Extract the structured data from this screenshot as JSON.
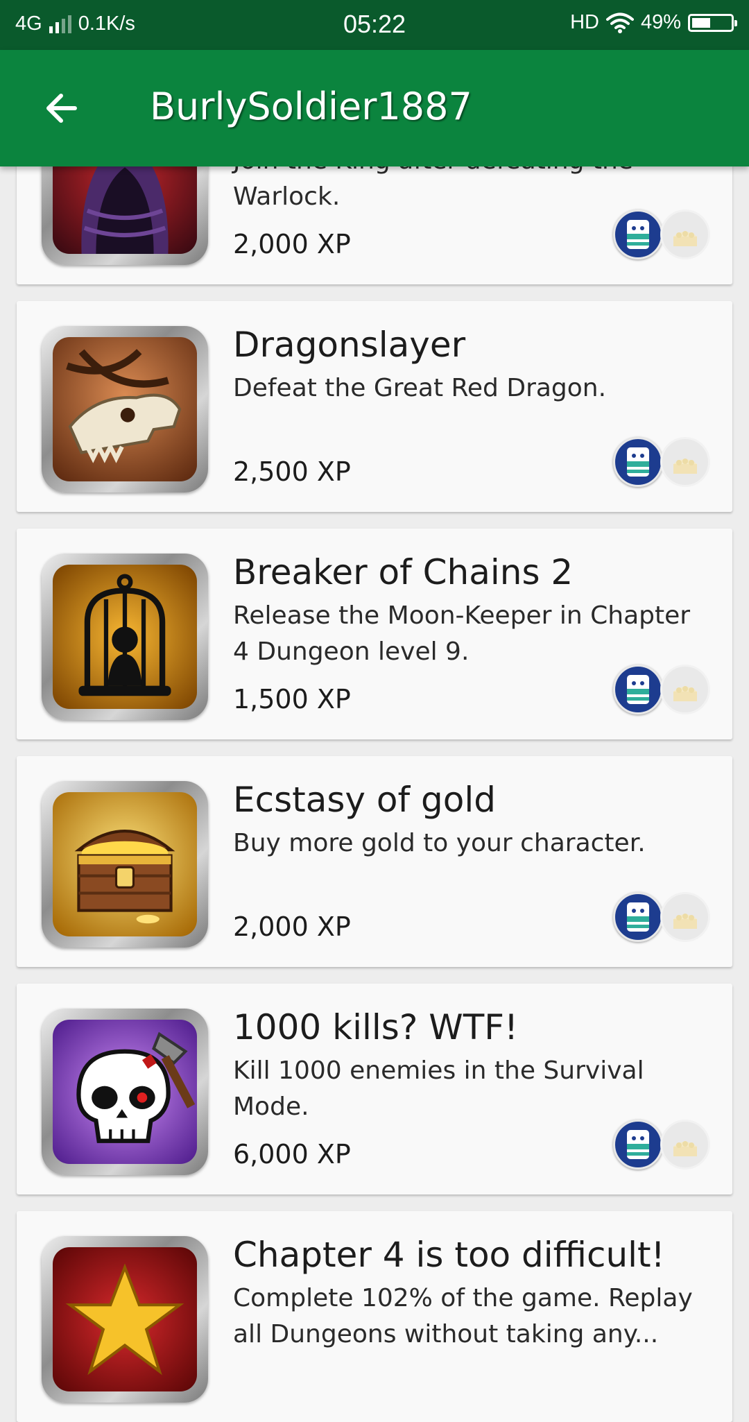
{
  "status_bar": {
    "network": "4G",
    "speed": "0.1K/s",
    "time": "05:22",
    "hd": "HD",
    "battery_text": "49%",
    "battery_level": 0.49
  },
  "header": {
    "title": "BurlySoldier1887",
    "back_icon": "arrow-back-icon"
  },
  "achievements": [
    {
      "title": "",
      "description": "Join the King after defeating the Warlock.",
      "xp": "2,000 XP",
      "icon": "hooded-warlock-icon",
      "colors": {
        "bg1": "#c3262b",
        "bg2": "#3c0a12"
      }
    },
    {
      "title": "Dragonslayer",
      "description": "Defeat the Great Red Dragon.",
      "xp": "2,500 XP",
      "icon": "dragon-skull-icon",
      "colors": {
        "bg1": "#d98a52",
        "bg2": "#5e2a10"
      }
    },
    {
      "title": "Breaker of Chains 2",
      "description": "Release the Moon-Keeper in Chapter 4 Dungeon level 9.",
      "xp": "1,500 XP",
      "icon": "birdcage-icon",
      "colors": {
        "bg1": "#f7b632",
        "bg2": "#7a4200"
      }
    },
    {
      "title": "Ecstasy of gold",
      "description": "Buy more gold to your character.",
      "xp": "2,000 XP",
      "icon": "treasure-chest-icon",
      "colors": {
        "bg1": "#fbe07a",
        "bg2": "#a76a06"
      }
    },
    {
      "title": "1000 kills? WTF!",
      "description": "Kill 1000 enemies in the Survival Mode.",
      "xp": "6,000 XP",
      "icon": "skull-axe-icon",
      "colors": {
        "bg1": "#cd8cf5",
        "bg2": "#4e1c8c"
      }
    },
    {
      "title": "Chapter 4 is too difficult!",
      "description": "Complete 102% of the game. Replay all Dungeons without taking any...",
      "xp": "",
      "icon": "gold-star-icon",
      "colors": {
        "bg1": "#d8292c",
        "bg2": "#5a0606"
      }
    }
  ]
}
